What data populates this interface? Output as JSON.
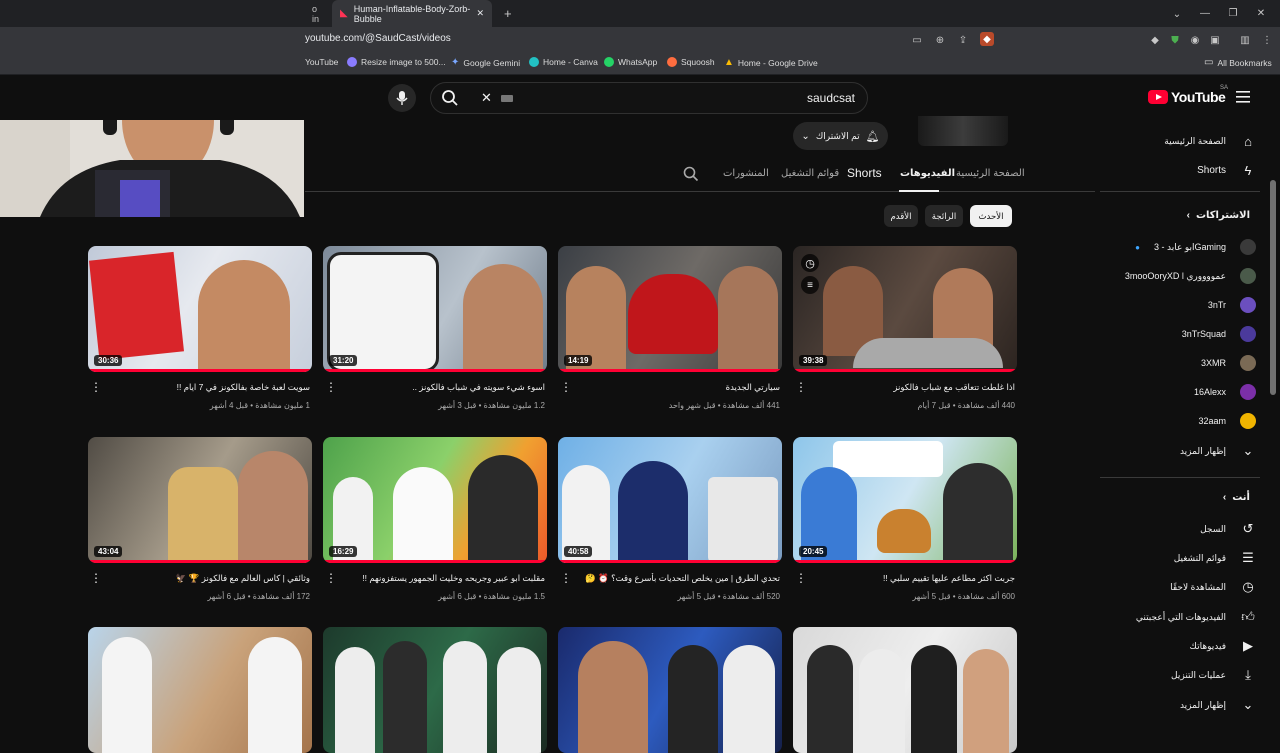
{
  "browser": {
    "tabs": [
      {
        "label": "o in"
      },
      {
        "label": "Human-Inflatable-Body-Zorb-Bubble"
      }
    ],
    "new_tab": "+",
    "url": "youtube.com/@SaudCast/videos",
    "bookmarks": [
      {
        "label": "YouTube",
        "color": "#ff0033"
      },
      {
        "label": "Resize image to 500...",
        "color": "#8a7cff"
      },
      {
        "label": "Google Gemini",
        "color": "#4f8df5"
      },
      {
        "label": "Home - Canva",
        "color": "#22c1c3"
      },
      {
        "label": "WhatsApp",
        "color": "#25d366"
      },
      {
        "label": "Squoosh",
        "color": "#ff6d3f"
      },
      {
        "label": "Home - Google Drive",
        "color": "#fbbc04"
      }
    ],
    "all_bookmarks": "All Bookmarks"
  },
  "header": {
    "search_value": "saudcsat",
    "logo": "YouTube",
    "logo_country": "SA"
  },
  "channel": {
    "subscribe_label": "تم الاشتراك",
    "tabs": [
      "الصفحة الرئيسية",
      "الفيديوهات",
      "Shorts",
      "قوائم التشغيل",
      "المنشورات"
    ],
    "active_tab": "الفيديوهات",
    "chips": [
      "الأحدث",
      "الرائجة",
      "الأقدم"
    ]
  },
  "videos": [
    {
      "title": "سويت لعبة خاصة بفالكونز في 7 ايام !!",
      "meta": "1 مليون مشاهدة • قبل 4 أشهر",
      "duration": "30:36"
    },
    {
      "title": "اسوء شيء سويته في شباب فالكونز ..",
      "meta": "1.2 مليون مشاهدة • قبل 3 أشهر",
      "duration": "31:20"
    },
    {
      "title": "سيارتي الجديدة",
      "meta": "441 ألف مشاهدة • قبل شهر واحد",
      "duration": "14:19"
    },
    {
      "title": "اذا غلطت تتعاقب مع شباب فالكونز",
      "meta": "440 ألف مشاهدة • قبل 7 أيام",
      "duration": "39:38"
    },
    {
      "title": "وثائقي | كاس العالم مع فالكونز 🏆 🦅",
      "meta": "172 ألف مشاهدة • قبل 6 أشهر",
      "duration": "43:04"
    },
    {
      "title": "مقلبت ابو عبير وجريحه وخليت الجمهور يستفزونهم !!",
      "meta": "1.5 مليون مشاهدة • قبل 6 أشهر",
      "duration": "16:29"
    },
    {
      "title": "تحدي الطرق | مين يخلص التحديات بأسرع وقت؟ ⏰ 🤔",
      "meta": "520 ألف مشاهدة • قبل 5 أشهر",
      "duration": "40:58"
    },
    {
      "title": "جربت اكثر مطاعم عليها تقييم سلبي !!",
      "meta": "600 ألف مشاهدة • قبل 5 أشهر",
      "duration": "20:45"
    },
    {
      "title": "",
      "meta": "",
      "duration": ""
    },
    {
      "title": "",
      "meta": "",
      "duration": ""
    },
    {
      "title": "",
      "meta": "",
      "duration": ""
    },
    {
      "title": "",
      "meta": "",
      "duration": ""
    }
  ],
  "sidebar": {
    "home": "الصفحة الرئيسية",
    "shorts": "Shorts",
    "subscriptions_title": "الاشتراكات",
    "subscriptions": [
      {
        "label": "ابو عابد - 3Gaming",
        "color": "#3a3a3a"
      },
      {
        "label": "3mooOoryXD l عمووووري",
        "color": "#4a5a4a"
      },
      {
        "label": "3nTr",
        "color": "#6b4fbf"
      },
      {
        "label": "3nTrSquad",
        "color": "#4b3a9c"
      },
      {
        "label": "3XMR",
        "color": "#7a6a55"
      },
      {
        "label": "16Alexx",
        "color": "#7b2fa8"
      },
      {
        "label": "32aam",
        "color": "#f0b400"
      }
    ],
    "show_more": "إظهار المزيد",
    "you_title": "أنت",
    "you_items": [
      "السجل",
      "قوائم التشغيل",
      "المشاهدة لاحقًا",
      "الفيديوهات التي أعجبتني",
      "فيديوهاتك",
      "عمليات التنزيل"
    ],
    "show_more_2": "إظهار المزيد"
  }
}
